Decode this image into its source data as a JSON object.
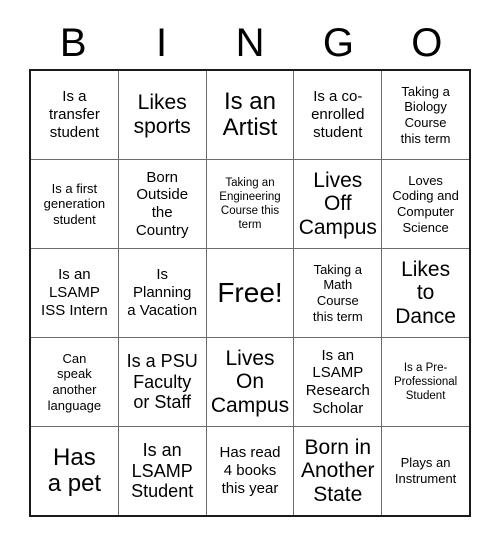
{
  "card": {
    "title": "BINGO",
    "header_letters": [
      "B",
      "I",
      "N",
      "G",
      "O"
    ],
    "grid_size": "5x5",
    "free_space": "Free!",
    "colors": {
      "background": "#ffffff",
      "text": "#000000",
      "outer_border": "#1a1a1a",
      "inner_border": "#6b6b6b"
    },
    "rows": [
      {
        "cells": [
          {
            "text": "Is a\ntransfer\nstudent",
            "size": "md"
          },
          {
            "text": "Likes\nsports",
            "size": "xl"
          },
          {
            "text": "Is an\nArtist",
            "size": "xxl"
          },
          {
            "text": "Is a co-\nenrolled\nstudent",
            "size": "md"
          },
          {
            "text": "Taking a\nBiology\nCourse\nthis term",
            "size": "sm"
          }
        ]
      },
      {
        "cells": [
          {
            "text": "Is a first\ngeneration\nstudent",
            "size": "sm"
          },
          {
            "text": "Born\nOutside\nthe\nCountry",
            "size": "md"
          },
          {
            "text": "Taking an\nEngineering\nCourse this\nterm",
            "size": "xs"
          },
          {
            "text": "Lives\nOff\nCampus",
            "size": "xl"
          },
          {
            "text": "Loves\nCoding and\nComputer\nScience",
            "size": "sm"
          }
        ]
      },
      {
        "cells": [
          {
            "text": "Is an\nLSAMP\nISS Intern",
            "size": "md"
          },
          {
            "text": "Is\nPlanning\na Vacation",
            "size": "md"
          },
          {
            "text": "Free!",
            "size": "free"
          },
          {
            "text": "Taking a\nMath\nCourse\nthis term",
            "size": "sm"
          },
          {
            "text": "Likes\nto\nDance",
            "size": "xl"
          }
        ]
      },
      {
        "cells": [
          {
            "text": "Can\nspeak\nanother\nlanguage",
            "size": "sm"
          },
          {
            "text": "Is a PSU\nFaculty\nor Staff",
            "size": "lg"
          },
          {
            "text": "Lives\nOn\nCampus",
            "size": "xl"
          },
          {
            "text": "Is an\nLSAMP\nResearch\nScholar",
            "size": "md"
          },
          {
            "text": "Is a Pre-\nProfessional\nStudent",
            "size": "xs"
          }
        ]
      },
      {
        "cells": [
          {
            "text": "Has\na pet",
            "size": "xxl"
          },
          {
            "text": "Is an\nLSAMP\nStudent",
            "size": "lg"
          },
          {
            "text": "Has read\n4 books\nthis year",
            "size": "md"
          },
          {
            "text": "Born in\nAnother\nState",
            "size": "xl"
          },
          {
            "text": "Plays an\nInstrument",
            "size": "sm"
          }
        ]
      }
    ]
  }
}
